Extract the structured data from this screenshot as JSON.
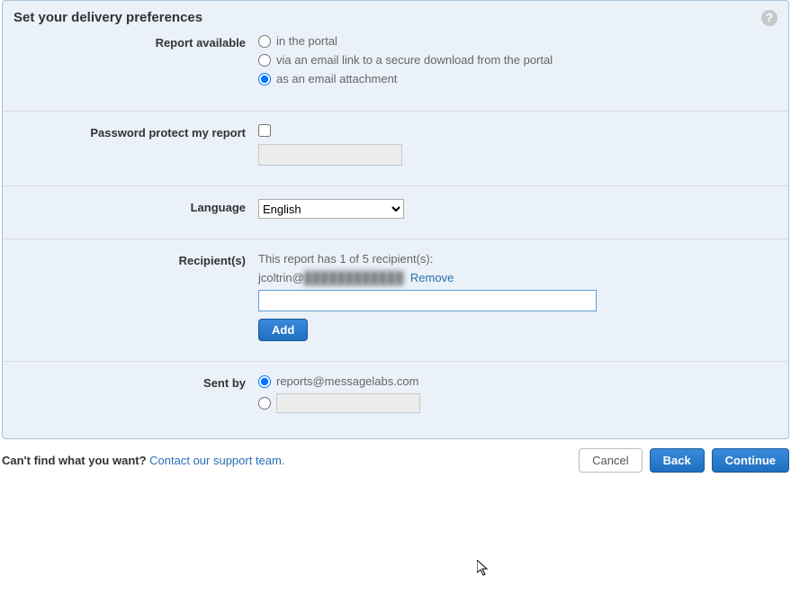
{
  "panel": {
    "title": "Set your delivery preferences"
  },
  "report_available": {
    "label": "Report available",
    "options": {
      "portal": "in the portal",
      "email_link": "via an email link to a secure download from the portal",
      "attachment": "as an email attachment"
    },
    "selected": "attachment"
  },
  "password": {
    "label": "Password protect my report",
    "checked": false,
    "value": ""
  },
  "language": {
    "label": "Language",
    "selected": "English",
    "options": [
      "English"
    ]
  },
  "recipients": {
    "label": "Recipient(s)",
    "info": "This report has 1 of 5 recipient(s):",
    "list": [
      {
        "prefix": "jcoltrin@",
        "masked": "████████████",
        "remove": "Remove"
      }
    ],
    "input_value": "",
    "add_label": "Add"
  },
  "sent_by": {
    "label": "Sent by",
    "default_address": "reports@messagelabs.com",
    "selected": "default",
    "custom_value": ""
  },
  "footer": {
    "question": "Can't find what you want?",
    "link": "Contact our support team.",
    "cancel": "Cancel",
    "back": "Back",
    "continue": "Continue"
  }
}
